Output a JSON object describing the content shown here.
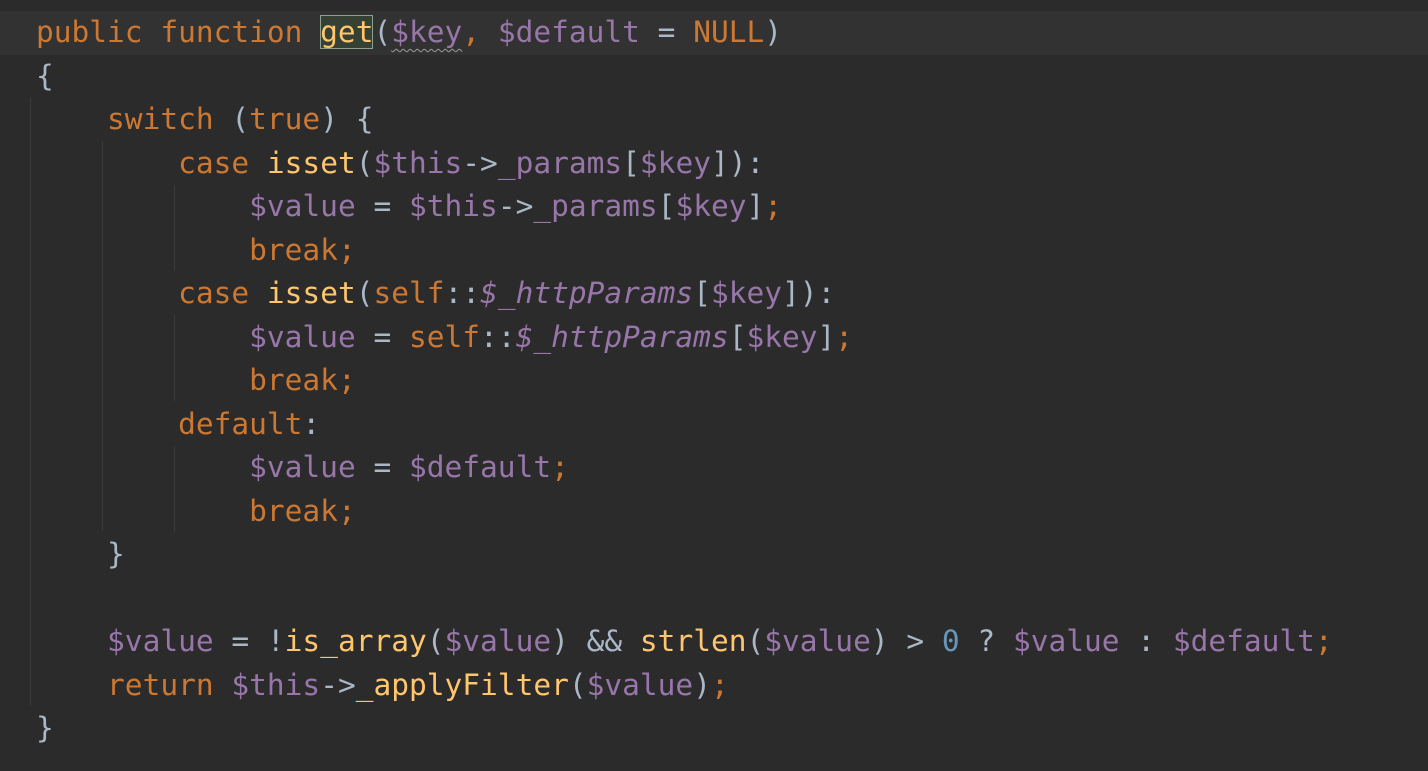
{
  "editor": {
    "language": "PHP",
    "theme_colors": {
      "background": "#2b2b2b",
      "current_line": "#323232",
      "keyword": "#cc7832",
      "function": "#ffc66d",
      "variable": "#9876aa",
      "plain": "#a9b7c6",
      "number": "#6897bb"
    },
    "highlighted_word": "get",
    "lines": [
      "public function get($key, $default = NULL)",
      "{",
      "    switch (true) {",
      "        case isset($this->_params[$key]):",
      "            $value = $this->_params[$key];",
      "            break;",
      "        case isset(self::$_httpParams[$key]):",
      "            $value = self::$_httpParams[$key];",
      "            break;",
      "        default:",
      "            $value = $default;",
      "            break;",
      "    }",
      "",
      "    $value = !is_array($value) && strlen($value) > 0 ? $value : $default;",
      "    return $this->_applyFilter($value);",
      "}"
    ]
  }
}
